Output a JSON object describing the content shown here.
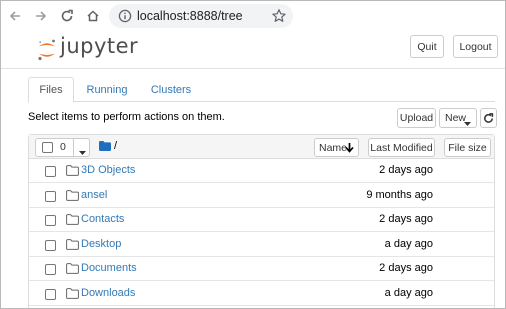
{
  "browser": {
    "url": "localhost:8888/tree",
    "icons": [
      "back-icon",
      "forward-icon",
      "reload-icon",
      "home-icon",
      "info-icon",
      "star-icon"
    ]
  },
  "header": {
    "logo_text": "jupyter",
    "quit_label": "Quit",
    "logout_label": "Logout"
  },
  "tabs": [
    {
      "label": "Files",
      "active": true
    },
    {
      "label": "Running",
      "active": false
    },
    {
      "label": "Clusters",
      "active": false
    }
  ],
  "toolbar": {
    "hint": "Select items to perform actions on them.",
    "upload_label": "Upload",
    "new_label": "New"
  },
  "list_header": {
    "selected_count": "0",
    "path": "/",
    "sort_name_label": "Name",
    "last_modified_label": "Last Modified",
    "file_size_label": "File size"
  },
  "rows": [
    {
      "name": "3D Objects",
      "modified": "2 days ago"
    },
    {
      "name": "ansel",
      "modified": "9 months ago"
    },
    {
      "name": "Contacts",
      "modified": "2 days ago"
    },
    {
      "name": "Desktop",
      "modified": "a day ago"
    },
    {
      "name": "Documents",
      "modified": "2 days ago"
    },
    {
      "name": "Downloads",
      "modified": "a day ago"
    }
  ],
  "colors": {
    "link": "#337ab7",
    "jupyter_orange": "#f37726",
    "folder_blue": "#1f6ebf"
  }
}
